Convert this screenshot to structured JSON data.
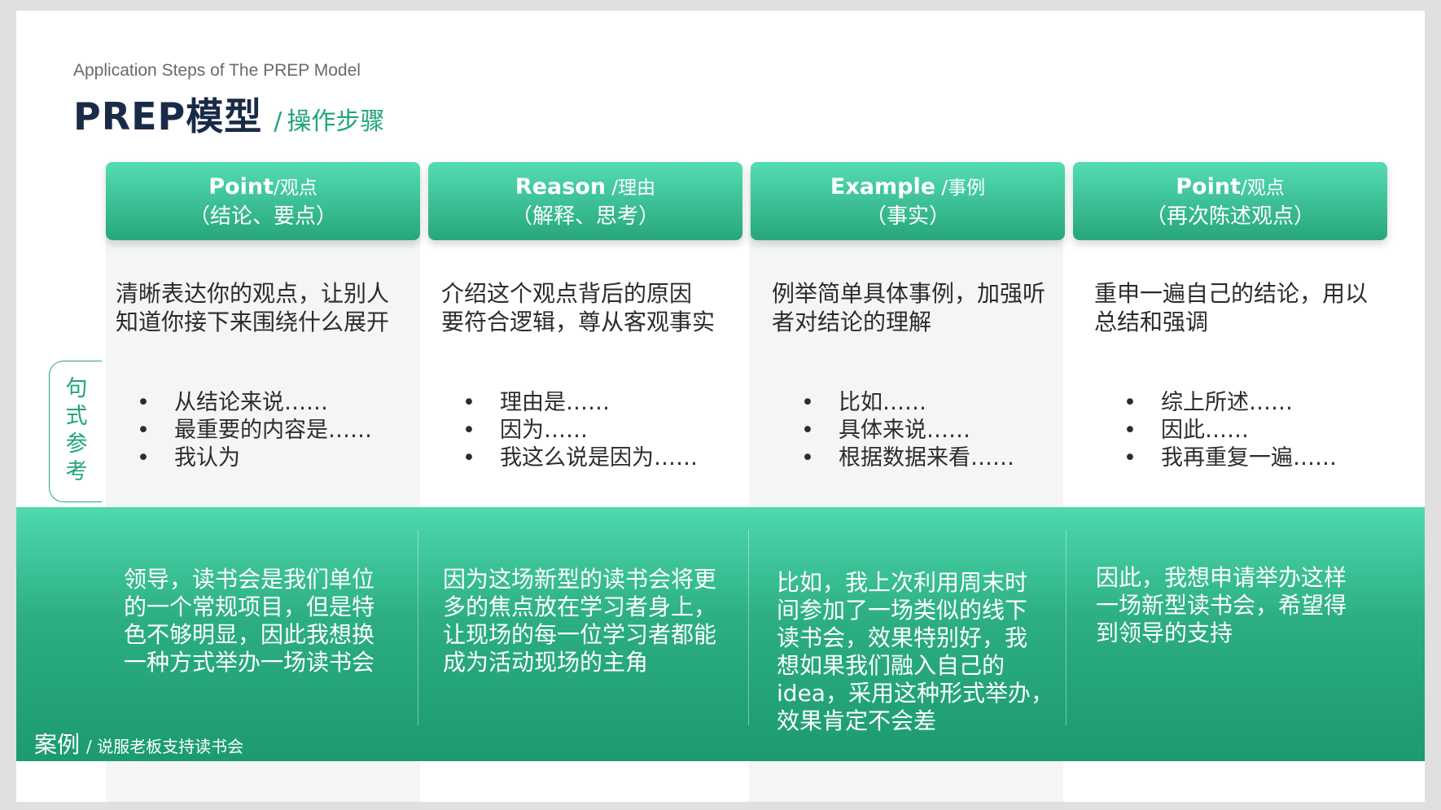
{
  "subtitle": "Application Steps of  The PREP Model",
  "title": {
    "main": "PREP模型",
    "separator": "/",
    "sub": "操作步骤"
  },
  "side_label": "句式参考",
  "columns": [
    {
      "header_en": "Point",
      "header_cn": "/观点",
      "header_note": "（结论、要点）",
      "desc": [
        "清晰表达你的观点，让别人",
        "知道你接下来围绕什么展开"
      ],
      "bullets": [
        "从结论来说……",
        "最重要的内容是……",
        "我认为"
      ],
      "case": [
        "领导，读书会是我们单位",
        "的一个常规项目，但是特",
        "色不够明显，因此我想换",
        "一种方式举办一场读书会"
      ]
    },
    {
      "header_en": "Reason",
      "header_cn": " /理由",
      "header_note": "（解释、思考）",
      "desc": [
        "介绍这个观点背后的原因",
        "要符合逻辑，尊从客观事实"
      ],
      "bullets": [
        "理由是……",
        "因为……",
        "我这么说是因为……"
      ],
      "case": [
        "因为这场新型的读书会将更",
        "多的焦点放在学习者身上，",
        "让现场的每一位学习者都能",
        "成为活动现场的主角"
      ]
    },
    {
      "header_en": "Example",
      "header_cn": " /事例",
      "header_note": "（事实）",
      "desc": [
        "例举简单具体事例，加强听",
        "者对结论的理解"
      ],
      "bullets": [
        "比如……",
        "具体来说……",
        "根据数据来看……"
      ],
      "case": [
        "比如，我上次利用周末时",
        "间参加了一场类似的线下",
        "读书会，效果特别好，我",
        "想如果我们融入自己的",
        "idea，采用这种形式举办，",
        "效果肯定不会差"
      ]
    },
    {
      "header_en": "Point",
      "header_cn": "/观点",
      "header_note": "（再次陈述观点）",
      "desc": [
        "重申一遍自己的结论，用以",
        "总结和强调"
      ],
      "bullets": [
        "综上所述……",
        "因此……",
        "我再重复一遍……"
      ],
      "case": [
        "因此，我想申请举办这样",
        "一场新型读书会，希望得",
        "到领导的支持"
      ]
    }
  ],
  "case_label": {
    "main": "案例",
    "sub": "/ 说服老板支持读书会"
  },
  "colors": {
    "accent": "#27a67c",
    "accent_light": "#55dcb3",
    "title_dark": "#1a2b48"
  }
}
